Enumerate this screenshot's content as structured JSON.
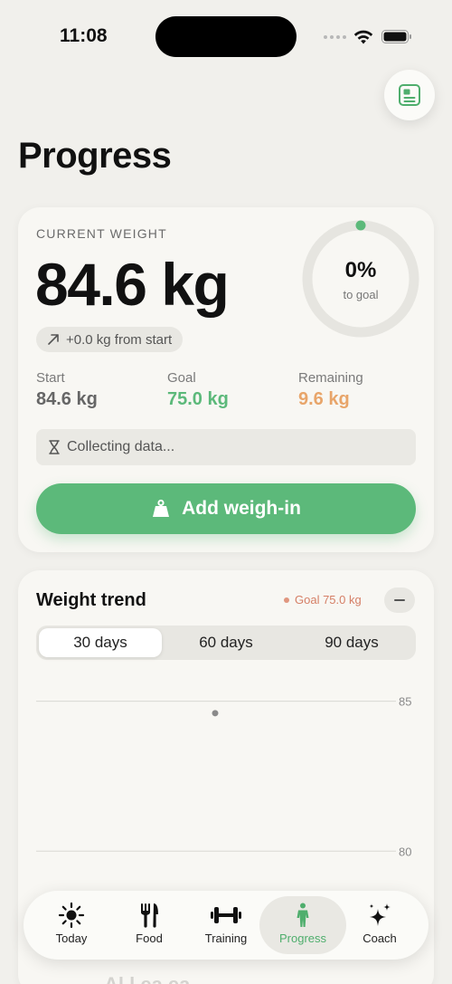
{
  "status_bar": {
    "time": "11:08"
  },
  "header": {
    "title": "Progress"
  },
  "current_weight": {
    "label": "CURRENT WEIGHT",
    "value": "84.6 kg",
    "progress_percent": "0%",
    "progress_fraction": 0,
    "progress_sub": "to goal",
    "delta": "+0.0 kg from start",
    "stats": [
      {
        "label": "Start",
        "value": "84.6 kg",
        "color": "#666666"
      },
      {
        "label": "Goal",
        "value": "75.0 kg",
        "color": "#5cb97a"
      },
      {
        "label": "Remaining",
        "value": "9.6 kg",
        "color": "#e8a56a"
      }
    ],
    "status_text": "Collecting data...",
    "add_button_label": "Add weigh-in"
  },
  "trend": {
    "title": "Weight trend",
    "goal_legend": "Goal 75.0 kg",
    "ranges": [
      "30 days",
      "60 days",
      "90 days"
    ],
    "selected_range": "30 days"
  },
  "chart_data": {
    "type": "scatter",
    "title": "Weight trend",
    "y_ticks": [
      "85",
      "80"
    ],
    "ylim": [
      78.5,
      85.5
    ],
    "points": [
      {
        "y": 84.6
      }
    ],
    "grid": true
  },
  "tabs": [
    {
      "label": "Today",
      "icon": "sun-icon"
    },
    {
      "label": "Food",
      "icon": "fork-knife-icon"
    },
    {
      "label": "Training",
      "icon": "dumbbell-icon"
    },
    {
      "label": "Progress",
      "icon": "figure-icon"
    },
    {
      "label": "Coach",
      "icon": "sparkles-icon"
    }
  ],
  "active_tab": "Progress",
  "colors": {
    "accent": "#5cb97a",
    "remaining": "#e8a56a",
    "goal_line": "#e0967f",
    "background": "#f1f0ec"
  },
  "partial_text_below_tabbar": "Al  l  ea  ea"
}
